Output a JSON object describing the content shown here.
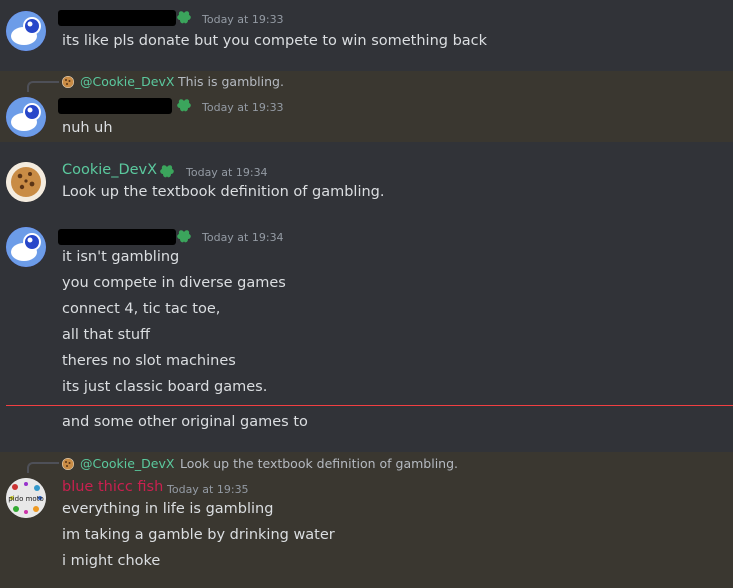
{
  "messages": {
    "m1": {
      "timestamp": "Today at 19:33",
      "lines": [
        "its like pls donate but you compete to win something back"
      ]
    },
    "m2": {
      "reply": {
        "mention": "@Cookie_DevX",
        "text": "This is gambling."
      },
      "timestamp": "Today at 19:33",
      "lines": [
        "nuh uh"
      ]
    },
    "m3": {
      "author": "Cookie_DevX",
      "timestamp": "Today at 19:34",
      "lines": [
        "Look up the textbook definition of gambling."
      ]
    },
    "m4": {
      "timestamp": "Today at 19:34",
      "lines": [
        "it isn't gambling",
        "you compete in diverse games",
        "connect 4, tic tac toe,",
        "all that stuff",
        "theres no slot machines",
        "its just classic board games.",
        "and some other original games to"
      ]
    },
    "m5": {
      "reply": {
        "mention": "@Cookie_DevX",
        "text": "Look up the textbook definition of gambling."
      },
      "author": "blue thicc fish",
      "timestamp": "Today at 19:35",
      "avatar_text": "pido moto",
      "lines": [
        "everything in life is gambling",
        "im taking a gamble by drinking water",
        "i might choke"
      ]
    }
  },
  "colors": {
    "background": "#313338",
    "highlight": "#3a3730",
    "cookie_name": "#5bc99e",
    "fish_name": "#c9204f",
    "divider": "#f23f42",
    "badge": "#3ba55c"
  }
}
